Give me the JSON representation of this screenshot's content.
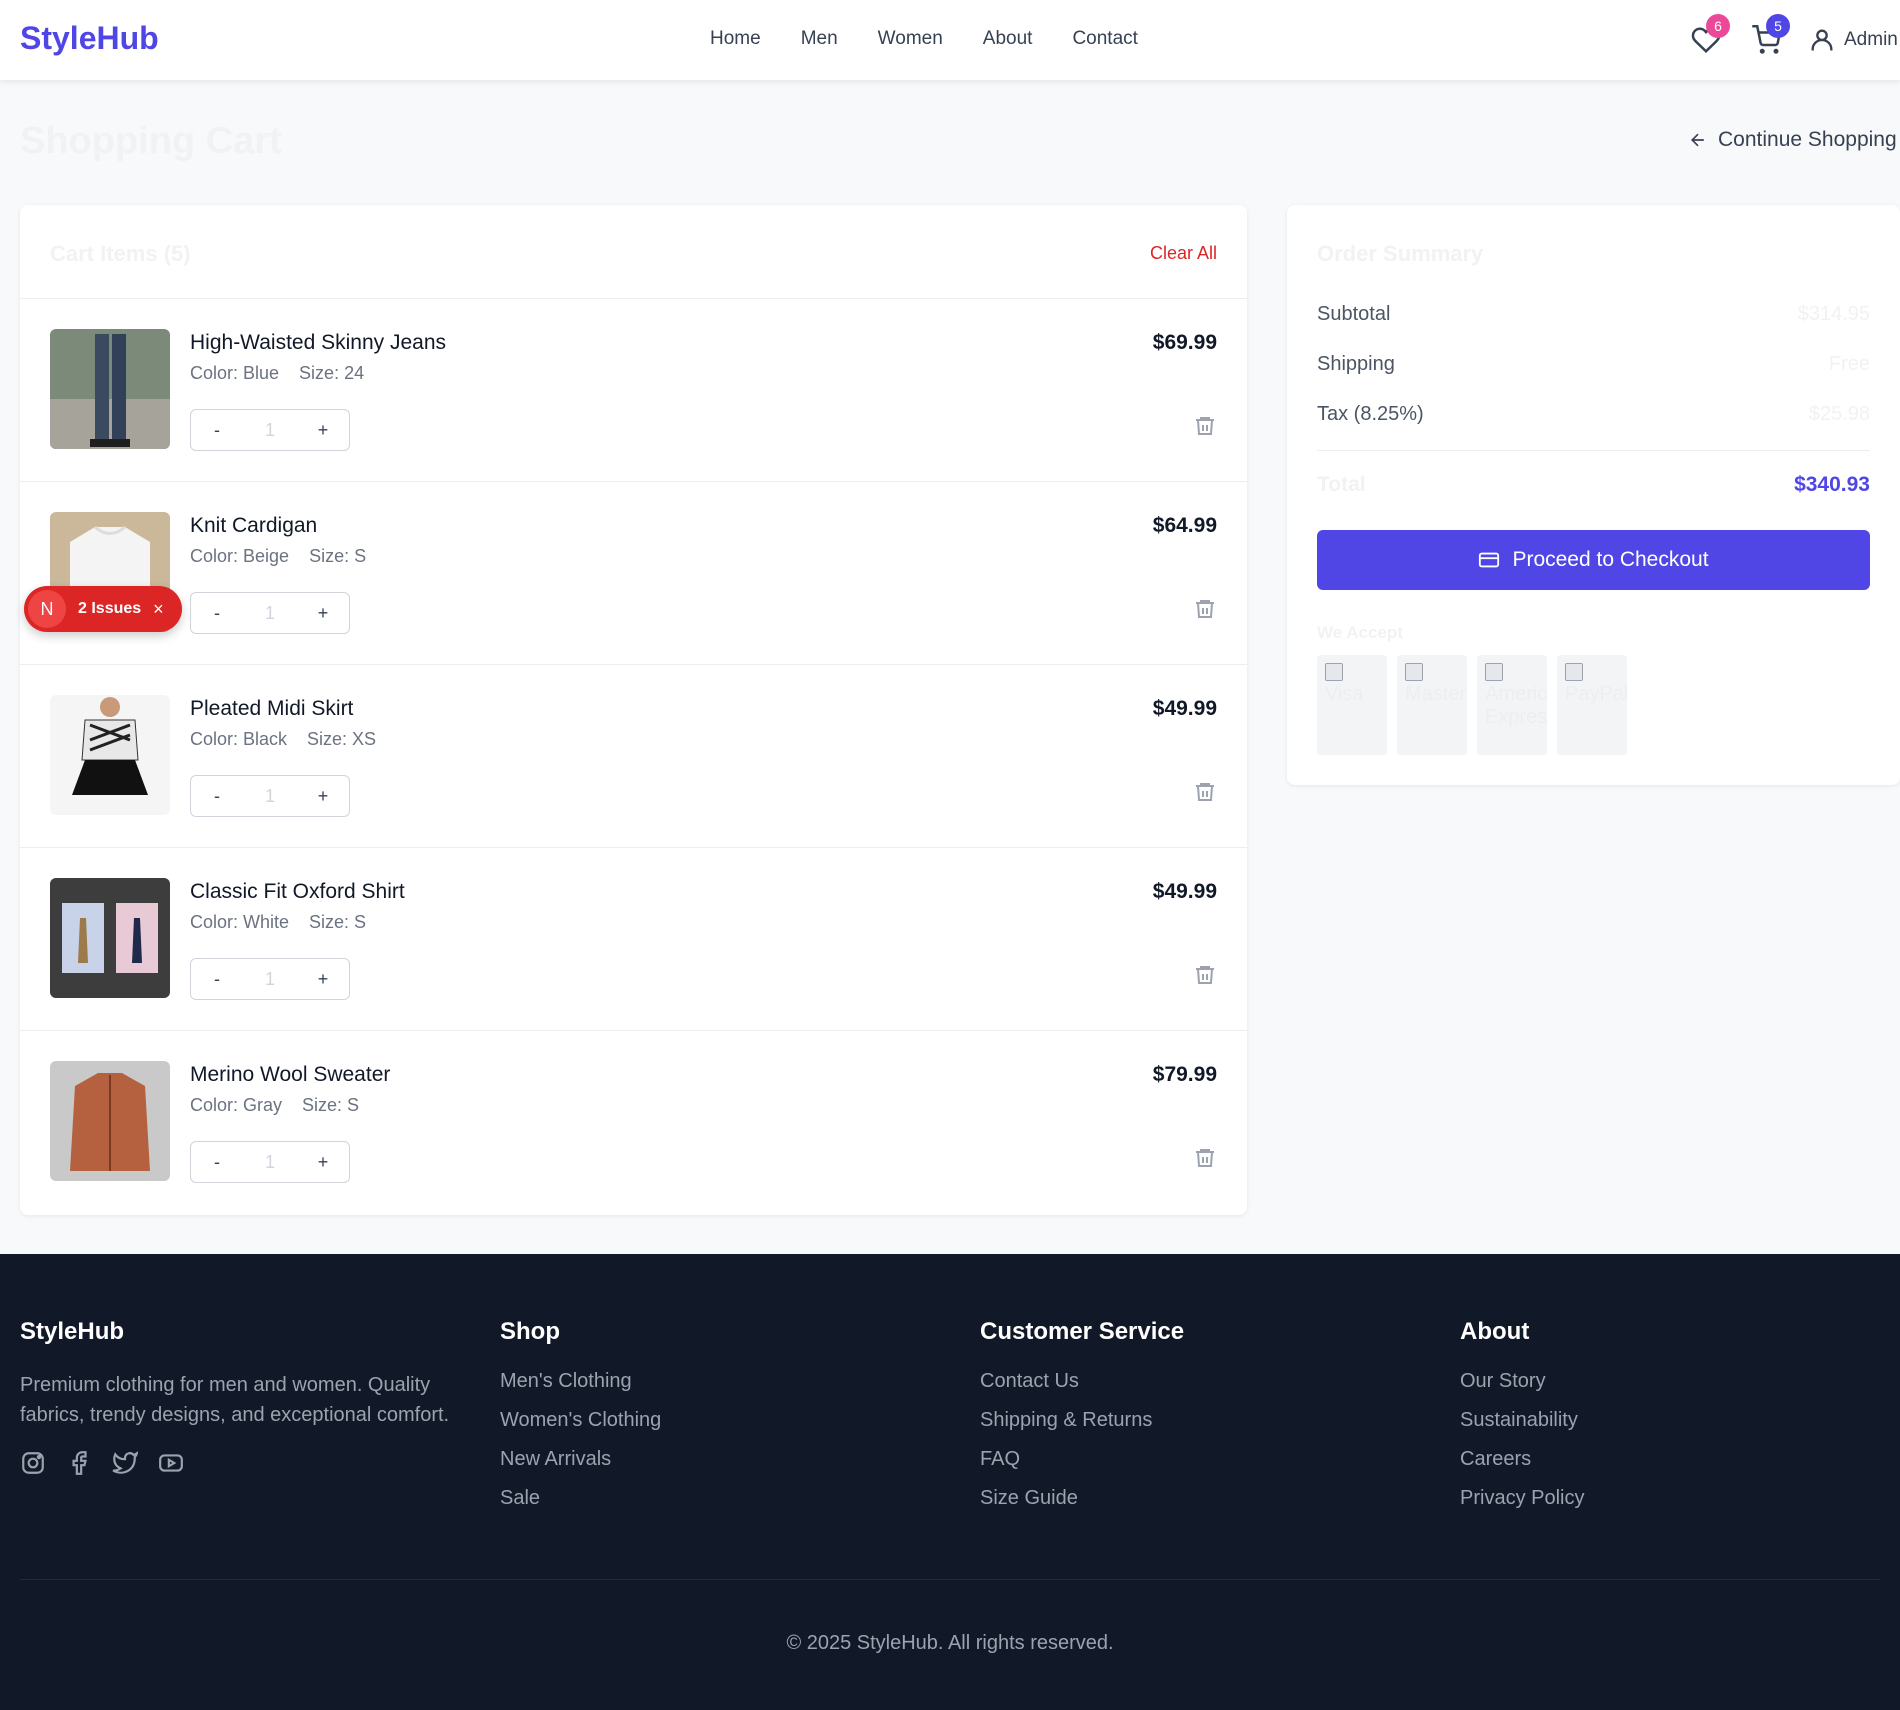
{
  "header": {
    "logo": "StyleHub",
    "nav": [
      "Home",
      "Men",
      "Women",
      "About",
      "Contact"
    ],
    "wishlist_count": "6",
    "cart_count": "5",
    "user_label": "Admin"
  },
  "page": {
    "title": "Shopping Cart",
    "continue_label": "Continue Shopping"
  },
  "cart": {
    "title": "Cart Items (5)",
    "clear_all": "Clear All",
    "items": [
      {
        "name": "High-Waisted Skinny Jeans",
        "color": "Color: Blue",
        "size": "Size: 24",
        "qty": "1",
        "price": "$69.99"
      },
      {
        "name": "Knit Cardigan",
        "color": "Color: Beige",
        "size": "Size: S",
        "qty": "1",
        "price": "$64.99"
      },
      {
        "name": "Pleated Midi Skirt",
        "color": "Color: Black",
        "size": "Size: XS",
        "qty": "1",
        "price": "$49.99"
      },
      {
        "name": "Classic Fit Oxford Shirt",
        "color": "Color: White",
        "size": "Size: S",
        "qty": "1",
        "price": "$49.99"
      },
      {
        "name": "Merino Wool Sweater",
        "color": "Color: Gray",
        "size": "Size: S",
        "qty": "1",
        "price": "$79.99"
      }
    ],
    "minus": "-",
    "plus": "+"
  },
  "issues": {
    "badge_letter": "N",
    "label": "2 Issues",
    "close": "×"
  },
  "summary": {
    "title": "Order Summary",
    "subtotal_label": "Subtotal",
    "subtotal_value": "$314.95",
    "shipping_label": "Shipping",
    "shipping_value": "Free",
    "tax_label": "Tax (8.25%)",
    "tax_value": "$25.98",
    "total_label": "Total",
    "total_value": "$340.93",
    "checkout_label": "Proceed to Checkout",
    "we_accept": "We Accept",
    "payment_alts": [
      "Visa",
      "Mastercard",
      "American Express",
      "PayPal"
    ]
  },
  "footer": {
    "brand": "StyleHub",
    "description": "Premium clothing for men and women. Quality fabrics, trendy designs, and exceptional comfort.",
    "shop_title": "Shop",
    "shop_links": [
      "Men's Clothing",
      "Women's Clothing",
      "New Arrivals",
      "Sale"
    ],
    "service_title": "Customer Service",
    "service_links": [
      "Contact Us",
      "Shipping & Returns",
      "FAQ",
      "Size Guide"
    ],
    "about_title": "About",
    "about_links": [
      "Our Story",
      "Sustainability",
      "Careers",
      "Privacy Policy"
    ],
    "copyright": "© 2025 StyleHub. All rights reserved."
  },
  "colors": {
    "accent": "#4f46e5",
    "danger": "#dc2626",
    "wishlist_badge": "#ec4899",
    "footer_bg": "#111827"
  }
}
